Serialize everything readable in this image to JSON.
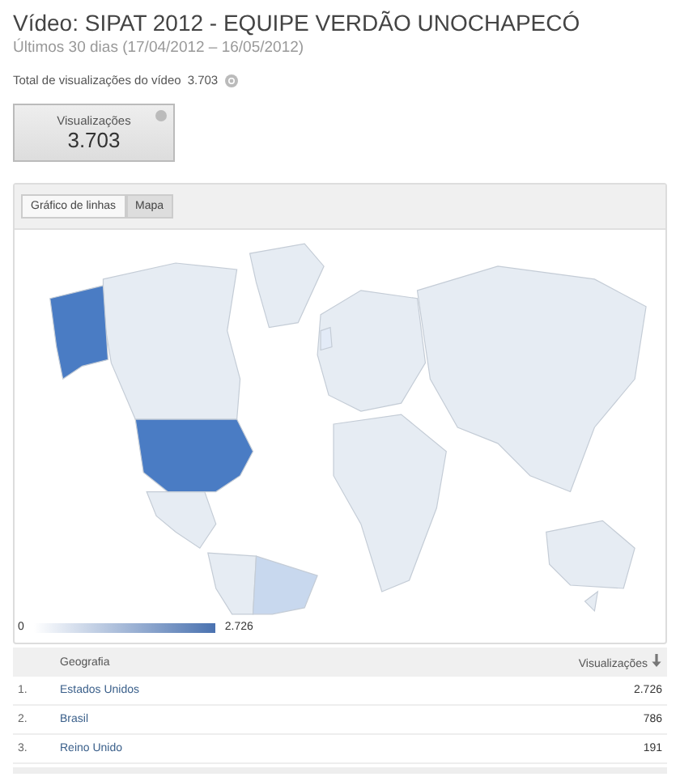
{
  "header": {
    "title": "Vídeo: SIPAT 2012 - EQUIPE VERDÃO UNOCHAPECÓ",
    "subtitle": "Últimos 30 dias (17/04/2012 – 16/05/2012)",
    "total_label": "Total de visualizações do vídeo",
    "total_value": "3.703"
  },
  "metric_card": {
    "label": "Visualizações",
    "value": "3.703"
  },
  "tabs": [
    {
      "label": "Gráfico de linhas",
      "selected": false
    },
    {
      "label": "Mapa",
      "selected": true
    }
  ],
  "legend": {
    "min": "0",
    "max": "2.726"
  },
  "table": {
    "columns": [
      "Geografia",
      "Visualizações"
    ],
    "rows": [
      {
        "rank": "1.",
        "name": "Estados Unidos",
        "views": "2.726"
      },
      {
        "rank": "2.",
        "name": "Brasil",
        "views": "786"
      },
      {
        "rank": "3.",
        "name": "Reino Unido",
        "views": "191"
      }
    ]
  }
}
